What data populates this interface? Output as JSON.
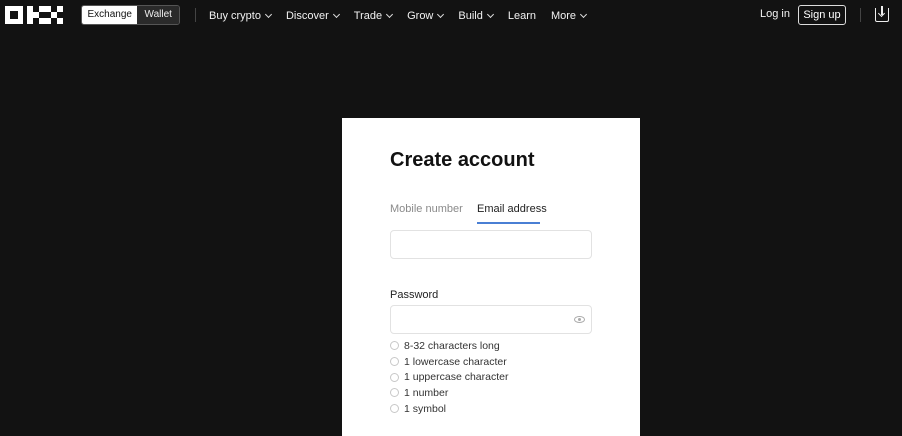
{
  "nav": {
    "switch": {
      "exchange": "Exchange",
      "wallet": "Wallet"
    },
    "menu": [
      {
        "label": "Buy crypto",
        "dropdown": true
      },
      {
        "label": "Discover",
        "dropdown": true
      },
      {
        "label": "Trade",
        "dropdown": true
      },
      {
        "label": "Grow",
        "dropdown": true
      },
      {
        "label": "Build",
        "dropdown": true
      },
      {
        "label": "Learn",
        "dropdown": false
      },
      {
        "label": "More",
        "dropdown": true
      }
    ],
    "login": "Log in",
    "signup": "Sign up",
    "download_icon": "download-icon"
  },
  "card": {
    "title": "Create account",
    "tabs": {
      "mobile": "Mobile number",
      "email": "Email address",
      "active": "email"
    },
    "email_value": "",
    "password_label": "Password",
    "password_value": "",
    "rules": [
      "8-32 characters long",
      "1 lowercase character",
      "1 uppercase character",
      "1 number",
      "1 symbol"
    ]
  },
  "colors": {
    "background": "#121212",
    "card": "#ffffff",
    "accent": "#4a7fd4"
  }
}
